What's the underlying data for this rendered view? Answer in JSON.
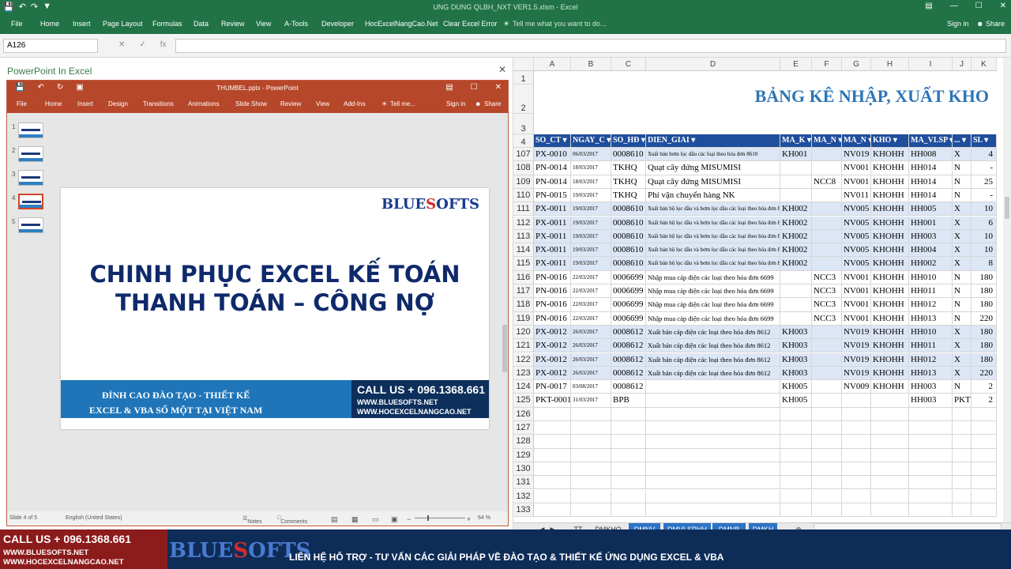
{
  "excel": {
    "window_title": "UNG DUNG QLBH_NXT VER1.5.xlsm - Excel",
    "tabs": [
      "File",
      "Home",
      "Insert",
      "Page Layout",
      "Formulas",
      "Data",
      "Review",
      "View",
      "A-Tools",
      "Developer",
      "HocExcelNangCao.Net",
      "Clear Excel Error"
    ],
    "tell_me": "Tell me what you want to do...",
    "sign_in": "Sign in",
    "share": "Share",
    "name_box": "A126",
    "fx": "fx"
  },
  "pane": {
    "title": "PowerPoint In Excel"
  },
  "ppt": {
    "window_title": "THUMBEL.pptx - PowerPoint",
    "tabs": [
      "File",
      "Home",
      "Insert",
      "Design",
      "Transitions",
      "Animations",
      "Slide Show",
      "Review",
      "View",
      "Add-Ins"
    ],
    "tell_me": "Tell me...",
    "sign_in": "Sign in",
    "share": "Share",
    "thumb_numbers": [
      "1",
      "2",
      "3",
      "4",
      "5"
    ],
    "slide": {
      "logo_a": "BLUE",
      "logo_b": "S",
      "logo_c": "OFTS",
      "headline1": "CHINH PHỤC EXCEL KẾ TOÁN",
      "headline2": "THANH TOÁN – CÔNG NỢ",
      "band_line1": "ĐỈNH CAO ĐÀO TẠO - THIẾT KẾ",
      "band_line2": "EXCEL & VBA SỐ MỘT TẠI VIỆT NAM",
      "call": "CALL US + 096.1368.661",
      "web1": "WWW.BLUESOFTS.NET",
      "web2": "WWW.HOCEXCELNANGCAO.NET"
    },
    "status": {
      "slide": "Slide 4 of 5",
      "lang": "English (United States)",
      "notes": "Notes",
      "comments": "Comments",
      "zoom": "64 %"
    }
  },
  "sheet": {
    "columns": [
      "A",
      "B",
      "C",
      "D",
      "E",
      "F",
      "G",
      "H",
      "I",
      "J",
      "K"
    ],
    "title": "BẢNG KÊ NHẬP, XUẤT KHO",
    "top_rows": [
      "1",
      "2",
      "3",
      "4"
    ],
    "headers": [
      "SO_CT",
      "NGAY_C",
      "SO_HĐ",
      "DIEN_GIAI",
      "MA_K",
      "MA_N",
      "MA_N",
      "KHO",
      "MA_VLSP",
      "...",
      "SL"
    ],
    "rows": [
      {
        "n": "107",
        "c": [
          "PX-0010",
          "06/03/2017",
          "0008610",
          "Xuất bán bơm lọc dầu các loại theo hóa đơn 8610",
          "KH001",
          "",
          "NV019",
          "KHOHH",
          "HH008",
          "X",
          "4"
        ],
        "s": "small",
        "b": true
      },
      {
        "n": "108",
        "c": [
          "PN-0014",
          "18/03/2017",
          "TKHQ",
          "Quạt cây đứng MISUMISI",
          "",
          "",
          "NV001",
          "KHOHH",
          "HH014",
          "N",
          "-"
        ],
        "s": "",
        "b": false
      },
      {
        "n": "109",
        "c": [
          "PN-0014",
          "18/03/2017",
          "TKHQ",
          "Quạt cây đứng MISUMISI",
          "",
          "NCC8",
          "NV001",
          "KHOHH",
          "HH014",
          "N",
          "25"
        ],
        "s": "",
        "b": false
      },
      {
        "n": "110",
        "c": [
          "PN-0015",
          "19/03/2017",
          "TKHQ",
          "Phí vận chuyển hàng NK",
          "",
          "",
          "NV011",
          "KHOHH",
          "HH014",
          "N",
          "-"
        ],
        "s": "",
        "b": false
      },
      {
        "n": "111",
        "c": [
          "PX-0011",
          "19/03/2017",
          "0008610",
          "Xuất bán bộ lọc dầu và bơm lọc dầu các loại theo hóa đơn 8610",
          "KH002",
          "",
          "NV005",
          "KHOHH",
          "HH005",
          "X",
          "10"
        ],
        "s": "small",
        "b": true
      },
      {
        "n": "112",
        "c": [
          "PX-0011",
          "19/03/2017",
          "0008610",
          "Xuất bán bộ lọc dầu và bơm lọc dầu các loại theo hóa đơn 8610",
          "KH002",
          "",
          "NV005",
          "KHOHH",
          "HH001",
          "X",
          "6"
        ],
        "s": "small",
        "b": true
      },
      {
        "n": "113",
        "c": [
          "PX-0011",
          "19/03/2017",
          "0008610",
          "Xuất bán bộ lọc dầu và bơm lọc dầu các loại theo hóa đơn 8610",
          "KH002",
          "",
          "NV005",
          "KHOHH",
          "HH003",
          "X",
          "10"
        ],
        "s": "small",
        "b": true
      },
      {
        "n": "114",
        "c": [
          "PX-0011",
          "19/03/2017",
          "0008610",
          "Xuất bán bộ lọc dầu và bơm lọc dầu các loại theo hóa đơn 8610",
          "KH002",
          "",
          "NV005",
          "KHOHH",
          "HH004",
          "X",
          "10"
        ],
        "s": "small",
        "b": true
      },
      {
        "n": "115",
        "c": [
          "PX-0011",
          "19/03/2017",
          "0008610",
          "Xuất bán bộ lọc dầu và bơm lọc dầu các loại theo hóa đơn 8610",
          "KH002",
          "",
          "NV005",
          "KHOHH",
          "HH002",
          "X",
          "8"
        ],
        "s": "small",
        "b": true
      },
      {
        "n": "116",
        "c": [
          "PN-0016",
          "22/03/2017",
          "0006699",
          "Nhập mua cáp điện các loại theo hóa đơn 6699",
          "",
          "NCC3",
          "NV001",
          "KHOHH",
          "HH010",
          "N",
          "180"
        ],
        "s": "med",
        "b": false
      },
      {
        "n": "117",
        "c": [
          "PN-0016",
          "22/03/2017",
          "0006699",
          "Nhập mua cáp điện các loại theo hóa đơn 6699",
          "",
          "NCC3",
          "NV001",
          "KHOHH",
          "HH011",
          "N",
          "180"
        ],
        "s": "med",
        "b": false
      },
      {
        "n": "118",
        "c": [
          "PN-0016",
          "22/03/2017",
          "0006699",
          "Nhập mua cáp điện các loại theo hóa đơn 6699",
          "",
          "NCC3",
          "NV001",
          "KHOHH",
          "HH012",
          "N",
          "180"
        ],
        "s": "med",
        "b": false
      },
      {
        "n": "119",
        "c": [
          "PN-0016",
          "22/03/2017",
          "0006699",
          "Nhập mua cáp điện các loại theo hóa đơn 6699",
          "",
          "NCC3",
          "NV001",
          "KHOHH",
          "HH013",
          "N",
          "220"
        ],
        "s": "med",
        "b": false
      },
      {
        "n": "120",
        "c": [
          "PX-0012",
          "26/03/2017",
          "0008612",
          "Xuất bán cáp điện các loại theo hóa đơn 8612",
          "KH003",
          "",
          "NV019",
          "KHOHH",
          "HH010",
          "X",
          "180"
        ],
        "s": "med",
        "b": true
      },
      {
        "n": "121",
        "c": [
          "PX-0012",
          "26/03/2017",
          "0008612",
          "Xuất bán cáp điện các loại theo hóa đơn 8612",
          "KH003",
          "",
          "NV019",
          "KHOHH",
          "HH011",
          "X",
          "180"
        ],
        "s": "med",
        "b": true
      },
      {
        "n": "122",
        "c": [
          "PX-0012",
          "26/03/2017",
          "0008612",
          "Xuất bán cáp điện các loại theo hóa đơn 8612",
          "KH003",
          "",
          "NV019",
          "KHOHH",
          "HH012",
          "X",
          "180"
        ],
        "s": "med",
        "b": true
      },
      {
        "n": "123",
        "c": [
          "PX-0012",
          "26/03/2017",
          "0008612",
          "Xuất bán cáp điện các loại theo hóa đơn 8612",
          "KH003",
          "",
          "NV019",
          "KHOHH",
          "HH013",
          "X",
          "220"
        ],
        "s": "med",
        "b": true
      },
      {
        "n": "124",
        "c": [
          "PN-0017",
          "03/08/2017",
          "0008612",
          "",
          "KH005",
          "",
          "NV009",
          "KHOHH",
          "HH003",
          "N",
          "2"
        ],
        "s": "",
        "b": false
      },
      {
        "n": "125",
        "c": [
          "PKT-0001",
          "31/03/2017",
          "BPB",
          "",
          "KH005",
          "",
          "",
          "",
          "HH003",
          "PKT",
          "2"
        ],
        "s": "",
        "b": false
      }
    ],
    "empty_rows": [
      "126",
      "127",
      "128",
      "129",
      "130",
      "131",
      "132",
      "133"
    ]
  },
  "sheet_tabs": [
    "...",
    "TT",
    "DMKHO",
    "DMNV",
    "DMVLSPHH",
    "DMNB",
    "DMKH",
    "..."
  ],
  "banner": {
    "call": "CALL US + 096.1368.661",
    "site1": "WWW.BLUESOFTS.NET",
    "site2": "WWW.HOCEXCELNANGCAO.NET",
    "logo_a": "BLUE",
    "logo_b": "S",
    "logo_c": "OFTS",
    "message": "LIÊN HỆ HỖ TRỢ - TƯ VẤN CÁC GIẢI PHÁP VỀ ĐÀO TẠO & THIẾT KẾ ỨNG DỤNG EXCEL & VBA"
  },
  "colors": {
    "excel_green": "#217346",
    "ppt_red": "#b7472a",
    "table_header": "#1f4e9c",
    "row_blue": "#dce6f5",
    "title_blue": "#2e75b6"
  }
}
